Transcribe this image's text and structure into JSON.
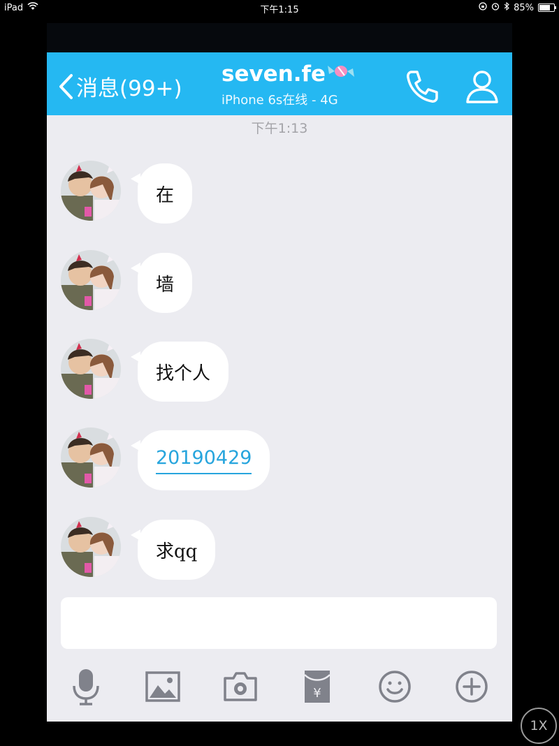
{
  "status_bar": {
    "device": "iPad",
    "time": "下午1:15",
    "battery": "85%",
    "battery_level": 0.85
  },
  "header": {
    "back_label": "消息(99+)",
    "contact_name": "seven.fe",
    "contact_status": "iPhone 6s在线 - 4G"
  },
  "timestamp": "下午1:13",
  "messages": [
    {
      "text": "在",
      "type": "text"
    },
    {
      "text": "墙",
      "type": "text"
    },
    {
      "text": "找个人",
      "type": "text"
    },
    {
      "text": "20190429",
      "type": "link"
    },
    {
      "text": "求qq",
      "type": "text"
    }
  ],
  "input": {
    "value": "",
    "placeholder": ""
  },
  "toolbar": [
    "mic-icon",
    "image-icon",
    "camera-icon",
    "red-packet-icon",
    "emoji-icon",
    "add-icon"
  ],
  "zoom_badge": "1X",
  "colors": {
    "navbar": "#25b8f2",
    "link": "#27a5dd",
    "chat_bg": "#ececf1"
  }
}
